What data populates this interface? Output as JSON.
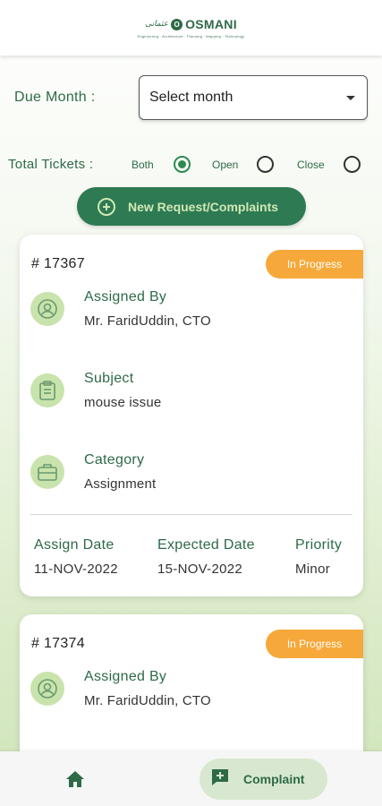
{
  "header": {
    "logo_urdu": "عثمانی",
    "logo_mark": "O",
    "logo_name": "OSMANI",
    "logo_tagline": "Engineering · Architecture · Planning · Mapping · Technology"
  },
  "filters": {
    "due_month_label": "Due Month :",
    "month_select_value": "Select month",
    "total_tickets_label": "Total Tickets :",
    "options": [
      {
        "label": "Both",
        "selected": true
      },
      {
        "label": "Open",
        "selected": false
      },
      {
        "label": "Close",
        "selected": false
      }
    ]
  },
  "new_request_label": "New Request/Complaints",
  "tickets": [
    {
      "number": "# 17367",
      "status": "In Progress",
      "assigned_by_label": "Assigned By",
      "assigned_by": "Mr. FaridUddin, CTO",
      "subject_label": "Subject",
      "subject": "mouse issue",
      "category_label": "Category",
      "category": "Assignment",
      "assign_date_label": "Assign Date",
      "assign_date": "11-NOV-2022",
      "expected_date_label": "Expected Date",
      "expected_date": "15-NOV-2022",
      "priority_label": "Priority",
      "priority": "Minor"
    },
    {
      "number": "# 17374",
      "status": "In Progress",
      "assigned_by_label": "Assigned By",
      "assigned_by": "Mr. FaridUddin, CTO"
    }
  ],
  "bottom_nav": {
    "home_icon": "home-icon",
    "complaint_icon": "add-comment-icon",
    "complaint_label": "Complaint"
  },
  "colors": {
    "primary_green": "#2e7a53",
    "status_orange": "#f6a93a",
    "icon_bg": "#c9e3ad"
  }
}
